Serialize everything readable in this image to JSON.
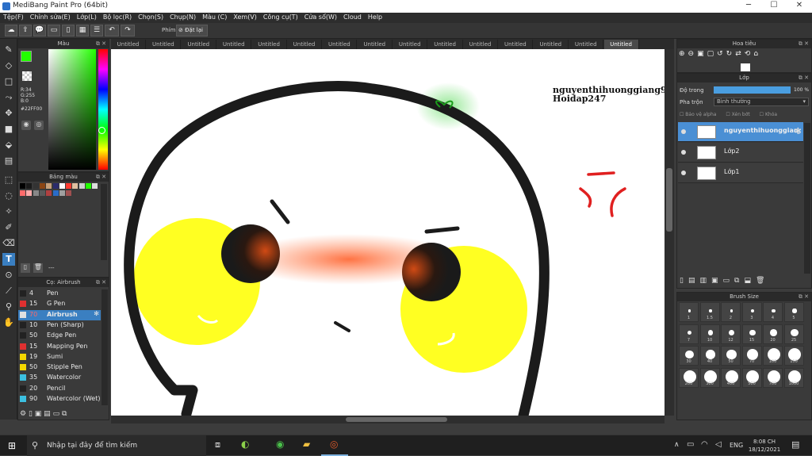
{
  "window": {
    "title": "MediBang Paint Pro (64bit)",
    "minimize": "─",
    "maximize": "☐",
    "close": "✕"
  },
  "menu": [
    "Tệp(F)",
    "Chỉnh sửa(E)",
    "Lớp(L)",
    "Bộ lọc(R)",
    "Chọn(S)",
    "Chụp(N)",
    "Màu (C)",
    "Xem(V)",
    "Công cụ(T)",
    "Cửa sổ(W)",
    "Cloud",
    "Help"
  ],
  "toolbar": {
    "shortcut_label": "Phím",
    "reset_label": "Đặt lại"
  },
  "color_panel": {
    "title": "Màu",
    "r": "R:34",
    "g": "G:255",
    "b": "B:0",
    "hex": "#22FF00",
    "fg": "#22ff00",
    "bg": "#000000"
  },
  "palette_panel": {
    "title": "Bảng màu",
    "more": "---",
    "swatches": [
      "#000000",
      "#1a1a1a",
      "#333333",
      "#8b4513",
      "#c8a07a",
      "#2b2b6b",
      "#ffffff",
      "#ff3b30",
      "#e0c0a0",
      "#cccccc",
      "#22ff00",
      "#dddddd",
      "#ff6a6a",
      "#ffaaaa",
      "#888888",
      "#5a5a5a",
      "#b04040",
      "#2a6cc8",
      "#a0a0a0",
      "#a05050"
    ]
  },
  "brush_panel": {
    "title": "Cọ: Airbrush",
    "brushes": [
      {
        "num": "4",
        "name": "Pen",
        "color": "#222222"
      },
      {
        "num": "15",
        "name": "G Pen",
        "color": "#e03030"
      },
      {
        "num": "70",
        "name": "Airbrush",
        "color": "#e0e0e0",
        "selected": true
      },
      {
        "num": "10",
        "name": "Pen (Sharp)",
        "color": "#222222"
      },
      {
        "num": "50",
        "name": "Edge Pen",
        "color": "#222222"
      },
      {
        "num": "15",
        "name": "Mapping Pen",
        "color": "#e03030"
      },
      {
        "num": "19",
        "name": "Sumi",
        "color": "#f5d800"
      },
      {
        "num": "50",
        "name": "Stipple Pen",
        "color": "#f5d800"
      },
      {
        "num": "35",
        "name": "Watercolor",
        "color": "#3cc0e0"
      },
      {
        "num": "20",
        "name": "Pencil",
        "color": "#222222"
      },
      {
        "num": "90",
        "name": "Watercolor (Wet)",
        "color": "#3cc0e0"
      }
    ]
  },
  "tabs": [
    "Untitled",
    "Untitled",
    "Untitled",
    "Untitled",
    "Untitled",
    "Untitled",
    "Untitled",
    "Untitled",
    "Untitled",
    "Untitled",
    "Untitled",
    "Untitled",
    "Untitled",
    "Untitled",
    "Untitled"
  ],
  "canvas": {
    "text_line1": "nguyenthihuonggiang94512",
    "text_line2": "Hoidap247"
  },
  "nav_panel": {
    "title": "Hoa tiêu"
  },
  "layer_panel": {
    "title": "Lớp",
    "opacity_label": "Độ trong",
    "opacity_value": "100 %",
    "opacity_fraction": 1.0,
    "blend_label": "Pha trộn",
    "blend_value": "Bình thường",
    "protect_alpha": "Bảo vệ alpha",
    "clip": "Xén bớt",
    "lock": "Khóa",
    "layers": [
      {
        "name": "nguyenthihuonggiang",
        "selected": true
      },
      {
        "name": "Lớp2",
        "selected": false
      },
      {
        "name": "Lớp1",
        "selected": false
      }
    ]
  },
  "brush_size_panel": {
    "title": "Brush Size",
    "sizes": [
      "1",
      "1.5",
      "2",
      "3",
      "4",
      "5",
      "7",
      "10",
      "12",
      "15",
      "20",
      "25",
      "30",
      "40",
      "50",
      "70",
      "100",
      "150",
      "200",
      "300",
      "400",
      "500",
      "700",
      "1000"
    ]
  },
  "taskbar": {
    "search_placeholder": "Nhập tại đây để tìm kiếm",
    "lang": "ENG",
    "time": "8:08 CH",
    "date": "18/12/2021"
  }
}
